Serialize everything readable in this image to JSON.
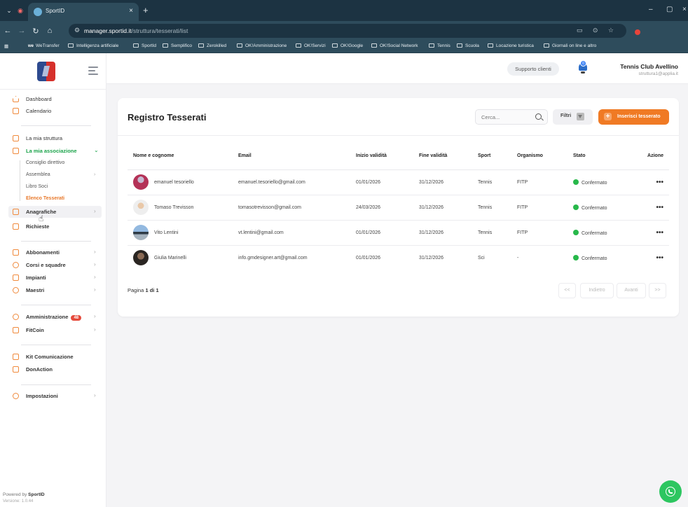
{
  "browser": {
    "tab_title": "SportID",
    "url_host": "manager.sportid.it",
    "url_path": "/struttura/tesserati/list",
    "bookmarks": [
      "WeTransfer",
      "Intelligenza artificiale",
      "SportId",
      "Semplifico",
      "Zerokilled",
      "OK!Amministrazione",
      "OK!Servizi",
      "OK!Google",
      "OK!Social Network",
      "Tennis",
      "Scuola",
      "Locazione turistica",
      "Giornali on line e altro"
    ]
  },
  "header": {
    "support_label": "Supporto clienti",
    "notification_count": "0",
    "club_name": "Tennis Club Avellino",
    "club_email": "struttura1@applia.it"
  },
  "sidebar": {
    "dashboard": "Dashboard",
    "calendario": "Calendario",
    "mia_struttura": "La mia struttura",
    "mia_associazione": "La mia associazione",
    "sub_items": [
      "Consiglio direttivo",
      "Assemblea",
      "Libro Soci",
      "Elenco Tesserati"
    ],
    "anagrafiche": "Anagrafiche",
    "richieste": "Richieste",
    "abbonamenti": "Abbonamenti",
    "corsi": "Corsi e squadre",
    "impianti": "Impianti",
    "maestri": "Maestri",
    "amministrazione": "Amministrazione",
    "amministrazione_badge": "48",
    "fitcoin": "FitCoin",
    "kit": "Kit Comunicazione",
    "donaction": "DonAction",
    "impostazioni": "Impostazioni",
    "powered_prefix": "Powered by",
    "powered_brand": "SportID",
    "version": "Versione: 1.0.44"
  },
  "main": {
    "title": "Registro Tesserati",
    "search_placeholder": "Cerca...",
    "filters_label": "Filtri",
    "add_label": "Inserisci tesserato",
    "columns": [
      "Nome e cognome",
      "Email",
      "Inizio validità",
      "Fine validità",
      "Sport",
      "Organismo",
      "Stato",
      "Azione"
    ],
    "rows": [
      {
        "name": "emanuel tesoriello",
        "email": "emanuel.tesoriello@gmail.com",
        "start": "01/01/2026",
        "end": "31/12/2026",
        "sport": "Tennis",
        "org": "FITP",
        "status": "Confermato"
      },
      {
        "name": "Tomaso Trevisson",
        "email": "tomasotrevisson@gmail.com",
        "start": "24/03/2026",
        "end": "31/12/2026",
        "sport": "Tennis",
        "org": "FITP",
        "status": "Confermato"
      },
      {
        "name": "Vito Lentini",
        "email": "vt.lentini@gmail.com",
        "start": "01/01/2026",
        "end": "31/12/2026",
        "sport": "Tennis",
        "org": "FITP",
        "status": "Confermato"
      },
      {
        "name": "Giulia Marinelli",
        "email": "info.gmdesigner.art@gmail.com",
        "start": "01/01/2026",
        "end": "31/12/2026",
        "sport": "Sci",
        "org": "-",
        "status": "Confermato"
      }
    ],
    "action_glyph": "•••",
    "status_color": "#27b84a",
    "pagination": {
      "prefix": "Pagina",
      "current": "1 di 1",
      "first": "<<",
      "prev": "Indietro",
      "next": "Avanti",
      "last": ">>"
    }
  },
  "colors": {
    "accent_orange": "#f07a24",
    "active_green": "#1aa34a",
    "browser_dark": "#1c3342"
  }
}
